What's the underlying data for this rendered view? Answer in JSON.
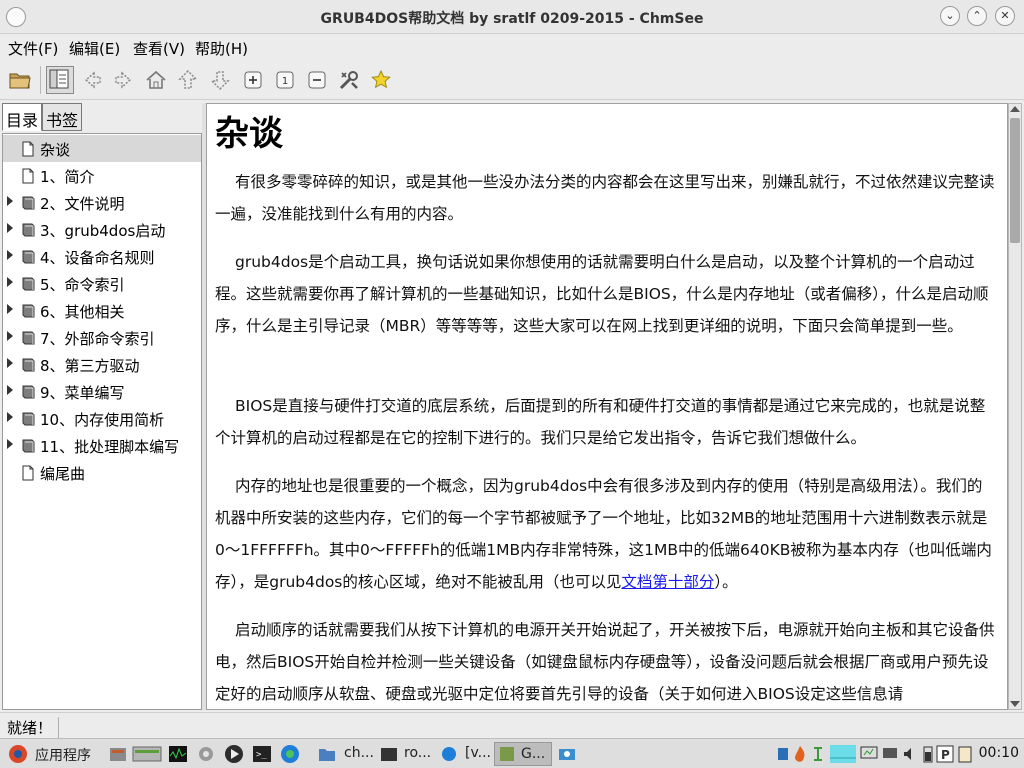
{
  "window": {
    "title": "GRUB4DOS帮助文档 by sratlf 0209-2015 - ChmSee",
    "buttons": [
      "⌄",
      "⌃",
      "✕"
    ]
  },
  "menubar": {
    "items": [
      "文件(F)",
      "编辑(E)",
      "查看(V)",
      "帮助(H)"
    ]
  },
  "toolbar": {
    "icons": [
      "open-folder",
      "toggle-sidebar",
      "back",
      "forward",
      "home",
      "previous",
      "next",
      "zoom-in",
      "zoom-reset",
      "zoom-out",
      "preferences",
      "favorite"
    ]
  },
  "sidebar": {
    "tabs": [
      "目录",
      "书签"
    ],
    "items": [
      {
        "label": "杂谈",
        "expandable": false,
        "selected": true
      },
      {
        "label": "1、简介",
        "expandable": false
      },
      {
        "label": "2、文件说明",
        "expandable": true
      },
      {
        "label": "3、grub4dos启动",
        "expandable": true
      },
      {
        "label": "4、设备命名规则",
        "expandable": true
      },
      {
        "label": "5、命令索引",
        "expandable": true
      },
      {
        "label": "6、其他相关",
        "expandable": true
      },
      {
        "label": "7、外部命令索引",
        "expandable": true
      },
      {
        "label": "8、第三方驱动",
        "expandable": true
      },
      {
        "label": "9、菜单编写",
        "expandable": true
      },
      {
        "label": "10、内存使用简析",
        "expandable": true
      },
      {
        "label": "11、批处理脚本编写",
        "expandable": true
      },
      {
        "label": "编尾曲",
        "expandable": false
      }
    ]
  },
  "content": {
    "heading": "杂谈",
    "p1": "有很多零零碎碎的知识，或是其他一些没办法分类的内容都会在这里写出来，别嫌乱就行，不过依然建议完整读一遍，没准能找到什么有用的内容。",
    "p2": "grub4dos是个启动工具，换句话说如果你想使用的话就需要明白什么是启动，以及整个计算机的一个启动过程。这些就需要你再了解计算机的一些基础知识，比如什么是BIOS，什么是内存地址（或者偏移），什么是启动顺序，什么是主引导记录（MBR）等等等等，这些大家可以在网上找到更详细的说明，下面只会简单提到一些。",
    "p3": "BIOS是直接与硬件打交道的底层系统，后面提到的所有和硬件打交道的事情都是通过它来完成的，也就是说整个计算机的启动过程都是在它的控制下进行的。我们只是给它发出指令，告诉它我们想做什么。",
    "p4_pre": "内存的地址也是很重要的一个概念，因为grub4dos中会有很多涉及到内存的使用（特别是高级用法）。我们的机器中所安装的这些内存，它们的每一个字节都被赋予了一个地址，比如32MB的地址范围用十六进制数表示就是0～1FFFFFFh。其中0～FFFFFh的低端1MB内存非常特殊，这1MB中的低端640KB被称为基本内存（也叫低端内存），是grub4dos的核心区域，绝对不能被乱用（也可以见",
    "p4_link": "文档第十部分",
    "p4_post": "）。",
    "p5": "启动顺序的话就需要我们从按下计算机的电源开关开始说起了，开关被按下后，电源就开始向主板和其它设备供电，然后BIOS开始自检并检测一些关键设备（如键盘鼠标内存硬盘等），设备没问题后就会根据厂商或用户预先设定好的启动顺序从软盘、硬盘或光驱中定位将要首先引导的设备（关于如何进入BIOS设定这些信息请"
  },
  "statusbar": {
    "text": "就绪！"
  },
  "taskbar": {
    "start_label": "应用程序",
    "tasks": [
      "ch...",
      "ro...",
      "[v...",
      "G..."
    ],
    "clock": "00:10"
  },
  "colors": {
    "link": "#1a1aee",
    "selection": "#d8d8d8"
  }
}
